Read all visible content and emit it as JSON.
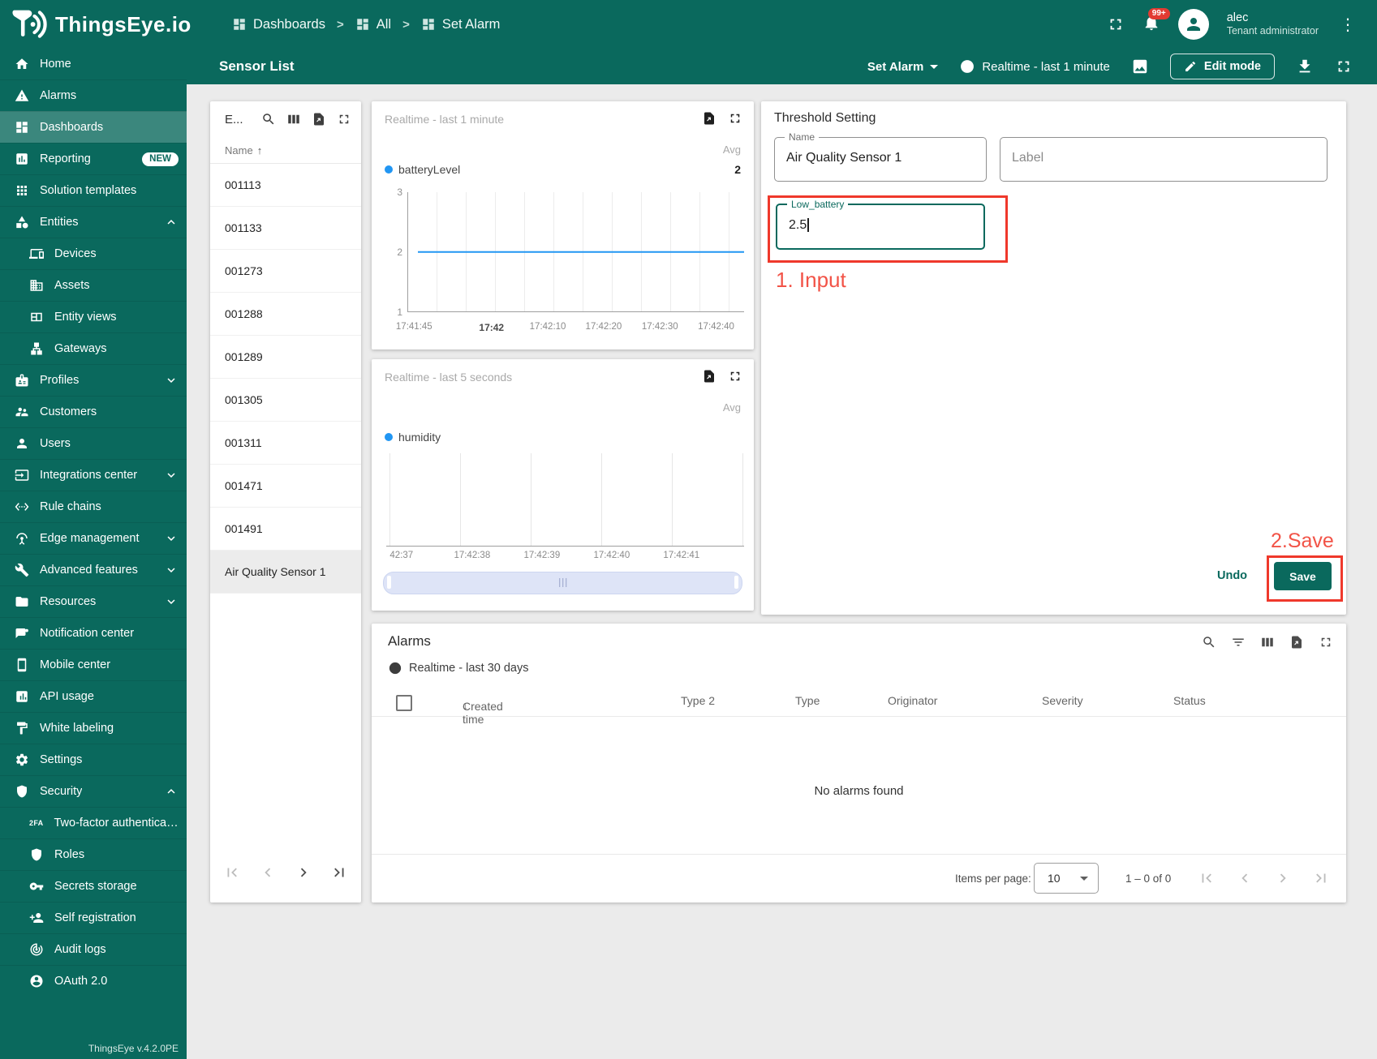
{
  "brand": {
    "logo_text": "ThingsEye.io",
    "version": "ThingsEye v.4.2.0PE",
    "color": "#0a695d"
  },
  "header": {
    "breadcrumbs": [
      "Dashboards",
      "All",
      "Set Alarm"
    ],
    "notifications_badge": "99+",
    "user": {
      "name": "alec",
      "role": "Tenant administrator"
    },
    "kebab": "⋮"
  },
  "toolbar": {
    "page_title": "Sensor List",
    "state_label": "Set Alarm",
    "timewindow": "Realtime - last 1 minute",
    "edit_mode_label": "Edit mode"
  },
  "sidebar": {
    "items": [
      {
        "label": "Home"
      },
      {
        "label": "Alarms"
      },
      {
        "label": "Dashboards"
      },
      {
        "label": "Reporting",
        "badge": "NEW"
      },
      {
        "label": "Solution templates"
      },
      {
        "label": "Entities"
      },
      {
        "label": "Devices"
      },
      {
        "label": "Assets"
      },
      {
        "label": "Entity views"
      },
      {
        "label": "Gateways"
      },
      {
        "label": "Profiles"
      },
      {
        "label": "Customers"
      },
      {
        "label": "Users"
      },
      {
        "label": "Integrations center"
      },
      {
        "label": "Rule chains"
      },
      {
        "label": "Edge management"
      },
      {
        "label": "Advanced features"
      },
      {
        "label": "Resources"
      },
      {
        "label": "Notification center"
      },
      {
        "label": "Mobile center"
      },
      {
        "label": "API usage"
      },
      {
        "label": "White labeling"
      },
      {
        "label": "Settings"
      },
      {
        "label": "Security"
      },
      {
        "label": "Two-factor authenticati...",
        "icon_text": "2FA"
      },
      {
        "label": "Roles"
      },
      {
        "label": "Secrets storage"
      },
      {
        "label": "Self registration"
      },
      {
        "label": "Audit logs"
      },
      {
        "label": "OAuth 2.0"
      }
    ],
    "version": "ThingsEye v.4.2.0PE"
  },
  "entity_list": {
    "title": "E...",
    "column": "Name",
    "sort_arrow": "↑",
    "rows": [
      "001113",
      "001133",
      "001273",
      "001288",
      "001289",
      "001305",
      "001311",
      "001471",
      "001491",
      "Air Quality Sensor 1"
    ],
    "selected_row": "Air Quality Sensor 1"
  },
  "widgets": {
    "battery": {
      "timewindow": "Realtime - last 1 minute",
      "agg_label": "Avg",
      "legend": "batteryLevel",
      "agg_value": "2",
      "y_ticks": [
        "3",
        "2",
        "1"
      ],
      "x_ticks": [
        "17:41:45",
        "17:42",
        "17:42:10",
        "17:42:20",
        "17:42:30",
        "17:42:40"
      ]
    },
    "humidity": {
      "timewindow": "Realtime - last 5 seconds",
      "agg_label": "Avg",
      "legend": "humidity",
      "x_ticks": [
        "42:37",
        "17:42:38",
        "17:42:39",
        "17:42:40",
        "17:42:41"
      ]
    }
  },
  "chart_data": [
    {
      "type": "line",
      "title": "batteryLevel",
      "timewindow": "Realtime - last 1 minute",
      "series": [
        {
          "name": "batteryLevel",
          "x": [
            "17:41:45",
            "17:42:45"
          ],
          "y": [
            2,
            2
          ]
        }
      ],
      "avg": 2,
      "ylim": [
        1,
        3
      ],
      "y_ticks": [
        1,
        2,
        3
      ],
      "x_ticks": [
        "17:41:45",
        "17:42",
        "17:42:10",
        "17:42:20",
        "17:42:30",
        "17:42:40"
      ],
      "grid": "vertical",
      "legend_position": "top-left",
      "line_color": "#2196f3"
    },
    {
      "type": "line",
      "title": "humidity",
      "timewindow": "Realtime - last 5 seconds",
      "series": [
        {
          "name": "humidity",
          "x": [],
          "y": []
        }
      ],
      "x_ticks": [
        "42:37",
        "17:42:38",
        "17:42:39",
        "17:42:40",
        "17:42:41"
      ],
      "grid": "vertical",
      "legend_position": "top-left",
      "note": "no data plotted"
    }
  ],
  "threshold": {
    "title": "Threshold Setting",
    "name_label": "Name",
    "name_value": "Air Quality Sensor 1",
    "label_placeholder": "Label",
    "threshold_label": "Low_battery",
    "threshold_value": "2.5",
    "undo_label": "Undo",
    "save_label": "Save"
  },
  "annotations": {
    "step1": "1. Input",
    "step2": "2.Save",
    "box_color": "#ef382b"
  },
  "alarms": {
    "title": "Alarms",
    "timewindow": "Realtime - last 30 days",
    "columns": [
      "Created time",
      "Type 2",
      "Type",
      "Originator",
      "Severity",
      "Status"
    ],
    "sort_arrow": "↓",
    "empty_text": "No alarms found",
    "items_per_page_label": "Items per page:",
    "items_per_page_value": "10",
    "range_text": "1 – 0 of 0"
  }
}
